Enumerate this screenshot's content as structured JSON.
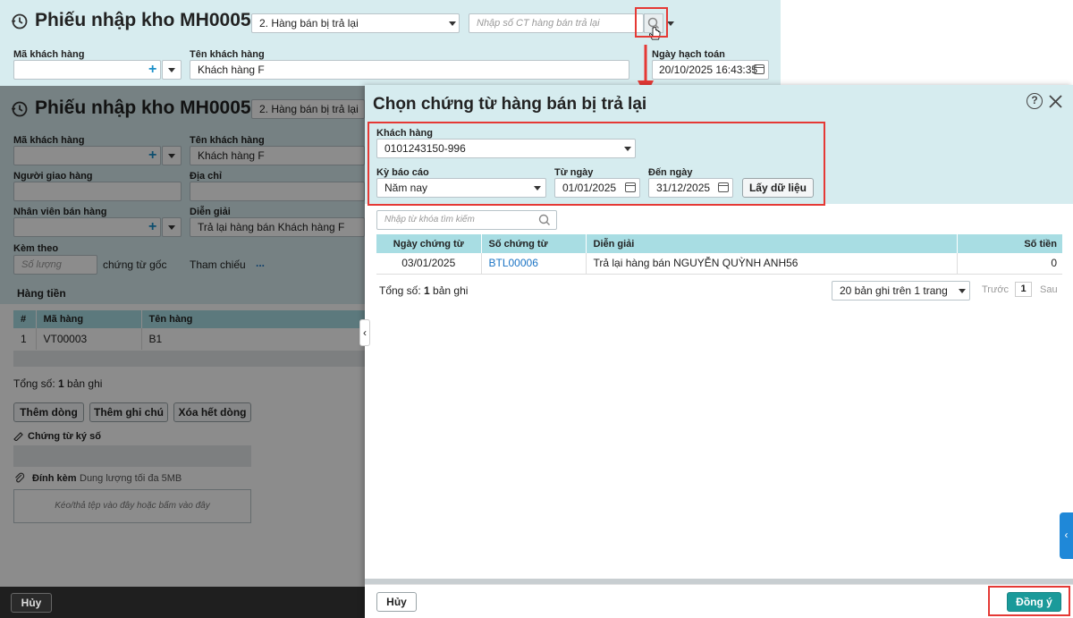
{
  "top": {
    "title": "Phiếu nhập kho MH0005",
    "type_select": "2. Hàng bán bị trả lại",
    "search_placeholder": "Nhập số CT hàng bán trả lại",
    "customer_code_label": "Mã khách hàng",
    "customer_name_label": "Tên khách hàng",
    "customer_name_value": "Khách hàng F",
    "date_label": "Ngày hạch toán",
    "date_value": "20/10/2025 16:43:35"
  },
  "back": {
    "title": "Phiếu nhập kho MH0005",
    "type_select": "2. Hàng bán bị trả lại",
    "customer_code_label": "Mã khách hàng",
    "customer_name_label": "Tên khách hàng",
    "customer_name_value": "Khách hàng F",
    "deliverer_label": "Người giao hàng",
    "address_label": "Địa chỉ",
    "sales_staff_label": "Nhân viên bán hàng",
    "description_label": "Diễn giải",
    "description_value": "Trả lại hàng bán Khách hàng F",
    "attached_label": "Kèm theo",
    "quantity_placeholder": "Số lượng",
    "original_docs": "chứng từ gốc",
    "reference_label": "Tham chiếu",
    "reference_more": "...",
    "tab_label": "Hàng tiền",
    "table": {
      "headers": [
        "#",
        "Mã hàng",
        "Tên hàng"
      ],
      "rows": [
        [
          "1",
          "VT00003",
          "B1"
        ]
      ]
    },
    "total_prefix": "Tổng số: ",
    "total_count": "1",
    "total_suffix": " bản ghi",
    "add_row": "Thêm dòng",
    "add_note": "Thêm ghi chú",
    "delete_all": "Xóa hết dòng",
    "signed_docs_label": "Chứng từ ký số",
    "attach_label": "Đính kèm",
    "attach_limit": "Dung lượng tối đa 5MB",
    "drop_hint": "Kéo/thả tệp vào đây hoặc bấm vào đây",
    "cancel": "Hủy"
  },
  "dialog": {
    "title": "Chọn chứng từ hàng bán bị trả lại",
    "customer_label": "Khách hàng",
    "customer_value": "0101243150-996",
    "period_label": "Kỳ báo cáo",
    "period_value": "Năm nay",
    "from_label": "Từ ngày",
    "from_value": "01/01/2025",
    "to_label": "Đến ngày",
    "to_value": "31/12/2025",
    "fetch_button": "Lấy dữ liệu",
    "search_placeholder": "Nhập từ khóa tìm kiếm",
    "table": {
      "headers": [
        "Ngày chứng từ",
        "Số chứng từ",
        "Diễn giải",
        "Số tiền"
      ],
      "rows": [
        [
          "03/01/2025",
          "BTL00006",
          "Trả lại hàng bán NGUYỄN QUỲNH ANH56",
          "0"
        ]
      ]
    },
    "total_prefix": "Tổng số: ",
    "total_count": "1",
    "total_suffix": " bản ghi",
    "page_size": "20 bản ghi trên 1 trang",
    "prev": "Trước",
    "page": "1",
    "next": "Sau",
    "cancel": "Hủy",
    "ok": "Đồng ý"
  },
  "colors": {
    "header_bg": "#d7ecef",
    "table_header": "#a8dde3",
    "primary": "#1a9a9a",
    "link": "#1a73c4",
    "highlight": "#e53935"
  }
}
